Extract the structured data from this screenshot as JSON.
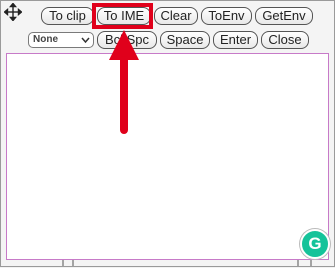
{
  "toolbar": {
    "row1": {
      "to_clip": "To clip",
      "to_ime": "To IME",
      "clear": "Clear",
      "to_env": "ToEnv",
      "get_env": "GetEnv"
    },
    "row2": {
      "select_value": "None",
      "bckspc": "BckSpc",
      "space": "Space",
      "enter": "Enter",
      "close": "Close"
    }
  },
  "editor": {
    "value": ""
  },
  "badge": {
    "label": "G"
  },
  "colors": {
    "highlight": "#e0001b",
    "textarea_border": "#c77ac8",
    "grammarly": "#15c39a"
  },
  "icons": [
    "move-icon",
    "chevron-down-icon",
    "arrow-up-icon",
    "grammarly-icon"
  ]
}
